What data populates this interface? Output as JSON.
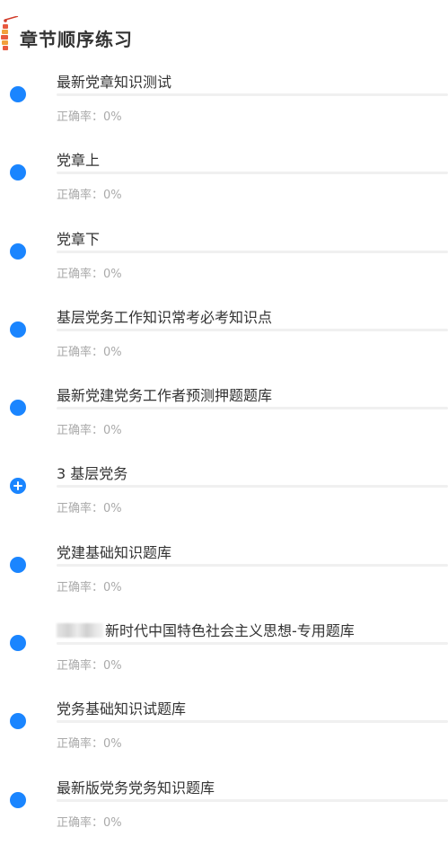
{
  "header": {
    "title": "章节顺序练习",
    "icon": "firecracker-icon"
  },
  "accent_color": "#1a85ff",
  "chapters": [
    {
      "title": "最新党章知识测试",
      "accuracy": "正确率：0%",
      "progress": 0,
      "icon": "dot-icon"
    },
    {
      "title": "党章上",
      "accuracy": "正确率：0%",
      "progress": 0,
      "icon": "dot-icon"
    },
    {
      "title": "党章下",
      "accuracy": "正确率：0%",
      "progress": 0,
      "icon": "dot-icon"
    },
    {
      "title": "基层党务工作知识常考必考知识点",
      "accuracy": "正确率：0%",
      "progress": 0,
      "icon": "dot-icon"
    },
    {
      "title": "最新党建党务工作者预测押题题库",
      "accuracy": "正确率：0%",
      "progress": 0,
      "icon": "dot-icon"
    },
    {
      "title": "3 基层党务",
      "accuracy": "正确率：0%",
      "progress": 0,
      "icon": "plus-icon"
    },
    {
      "title": "党建基础知识题库",
      "accuracy": "正确率：0%",
      "progress": 0,
      "icon": "dot-icon"
    },
    {
      "title": "新时代中国特色社会主义思想-专用题库",
      "accuracy": "正确率：0%",
      "progress": 0,
      "icon": "dot-icon"
    },
    {
      "title": "党务基础知识试题库",
      "accuracy": "正确率：0%",
      "progress": 0,
      "icon": "dot-icon"
    },
    {
      "title": "最新版党务党务知识题库",
      "accuracy": "正确率：0%",
      "progress": 0,
      "icon": "dot-icon"
    }
  ]
}
